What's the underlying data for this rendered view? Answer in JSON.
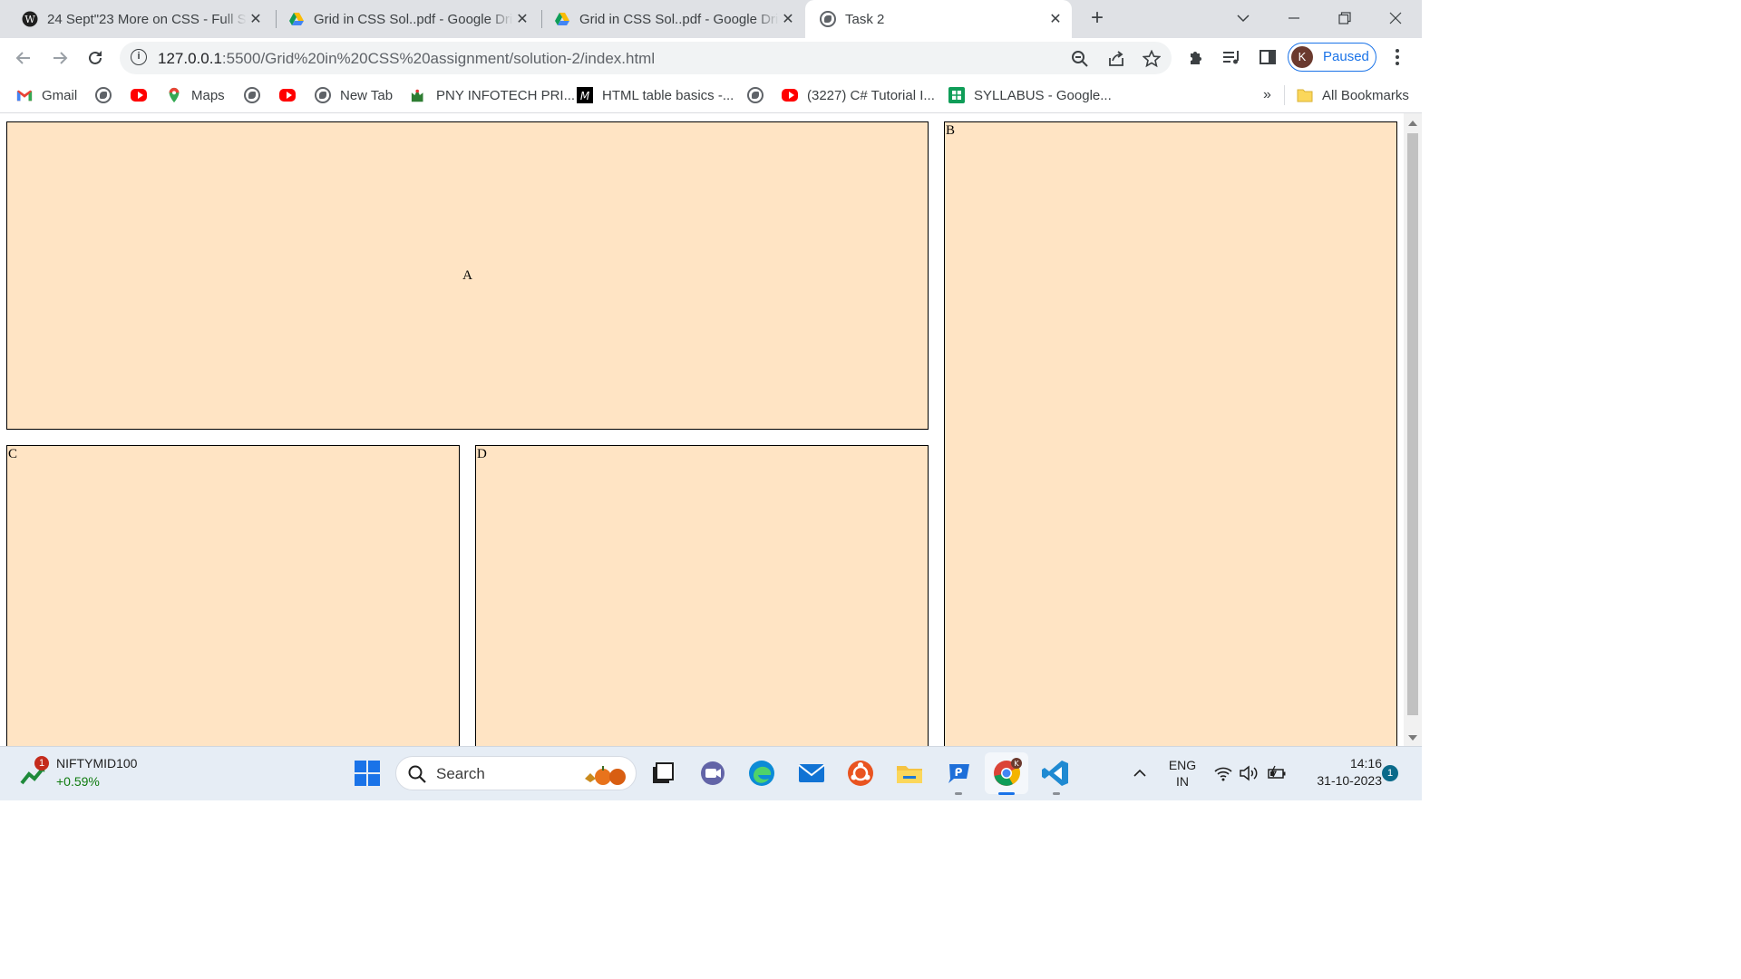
{
  "browser": {
    "tabs": [
      {
        "title": "24 Sept\"23 More on CSS - Full Stack",
        "icon": "wordpress-icon",
        "active": false
      },
      {
        "title": "Grid in CSS Sol..pdf - Google Drive",
        "icon": "google-drive-icon",
        "active": false
      },
      {
        "title": "Grid in CSS Sol..pdf - Google Drive",
        "icon": "google-drive-icon",
        "active": false
      },
      {
        "title": "Task 2",
        "icon": "globe-icon",
        "active": true
      }
    ],
    "tab_close_glyph": "✕",
    "new_tab_glyph": "+",
    "address": {
      "host": "127.0.0.1",
      "path": ":5500/Grid%20in%20CSS%20assignment/solution-2/index.html"
    },
    "profile": {
      "initial": "K",
      "status": "Paused"
    },
    "bookmarks": [
      {
        "label": "Gmail",
        "icon": "gmail-icon"
      },
      {
        "label": "",
        "icon": "globe-icon"
      },
      {
        "label": "",
        "icon": "youtube-icon"
      },
      {
        "label": "Maps",
        "icon": "maps-icon"
      },
      {
        "label": "",
        "icon": "globe-icon"
      },
      {
        "label": "",
        "icon": "youtube-icon"
      },
      {
        "label": "New Tab",
        "icon": "globe-icon"
      },
      {
        "label": "PNY INFOTECH PRI...",
        "icon": "pny-icon"
      },
      {
        "label": "HTML table basics -...",
        "icon": "mdn-icon"
      },
      {
        "label": "",
        "icon": "globe-icon"
      },
      {
        "label": "(3227) C# Tutorial I...",
        "icon": "youtube-icon"
      },
      {
        "label": "SYLLABUS - Google...",
        "icon": "google-sheets-icon"
      }
    ],
    "bookmarks_overflow": "»",
    "all_bookmarks": "All Bookmarks"
  },
  "page": {
    "cells": {
      "a": "A",
      "b": "B",
      "c": "C",
      "d": "D"
    },
    "cell_color": "#ffe4c4"
  },
  "taskbar": {
    "stock": {
      "badge": "1",
      "name": "NIFTYMID100",
      "change": "+0.59%"
    },
    "search_label": "Search",
    "language": {
      "line1": "ENG",
      "line2": "IN"
    },
    "clock": {
      "time": "14:16",
      "date": "31-10-2023"
    },
    "notification_count": "1"
  }
}
